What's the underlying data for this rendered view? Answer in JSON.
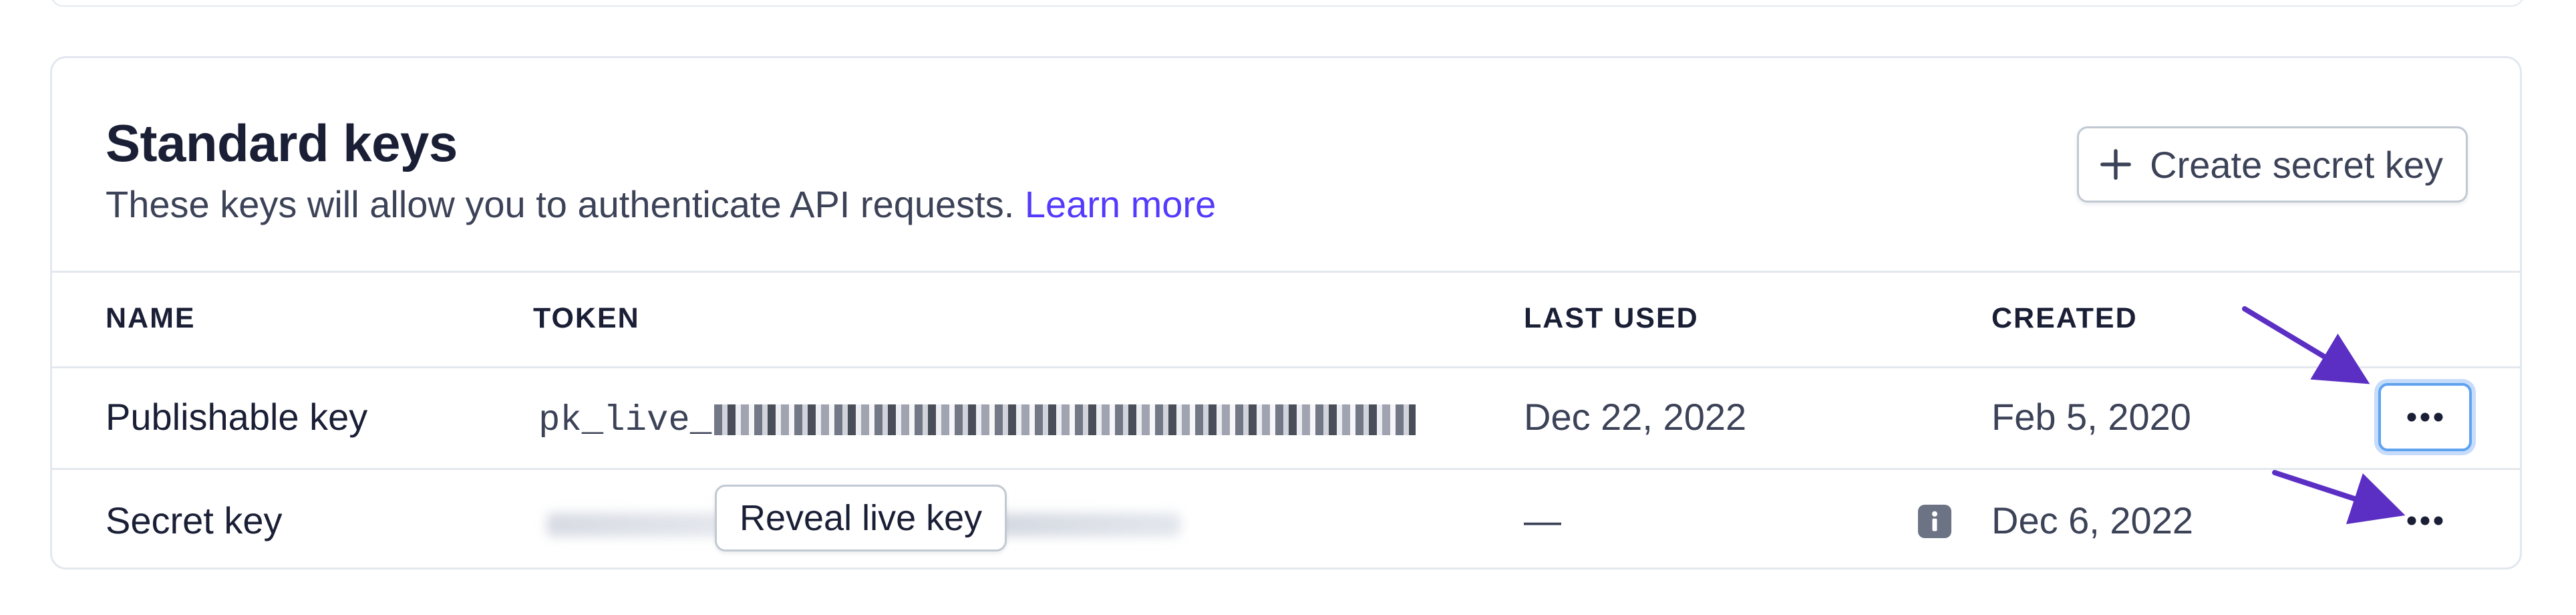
{
  "section": {
    "title": "Standard keys",
    "subtitle": "These keys will allow you to authenticate API requests.",
    "learn_more": "Learn more",
    "create_button_label": "Create secret key",
    "create_button_icon": "plus-icon"
  },
  "table": {
    "columns": [
      "NAME",
      "TOKEN",
      "LAST USED",
      "CREATED"
    ],
    "rows": [
      {
        "name": "Publishable key",
        "token_prefix": "pk_live_",
        "token_obscured": true,
        "last_used": "Dec 22, 2022",
        "created": "Feb 5, 2020",
        "actions_icon": "more-horizontal-icon"
      },
      {
        "name": "Secret key",
        "token_obscured": true,
        "reveal_label": "Reveal live key",
        "last_used": "—",
        "info_icon": "info-icon",
        "created": "Dec 6, 2022",
        "actions_icon": "more-horizontal-icon"
      }
    ]
  },
  "colors": {
    "accent": "#533afd",
    "annotation_arrow": "#5b2fc4",
    "focus_ring": "#5fa3f0",
    "border": "#e3e8ee",
    "text": "#1a1f36"
  }
}
